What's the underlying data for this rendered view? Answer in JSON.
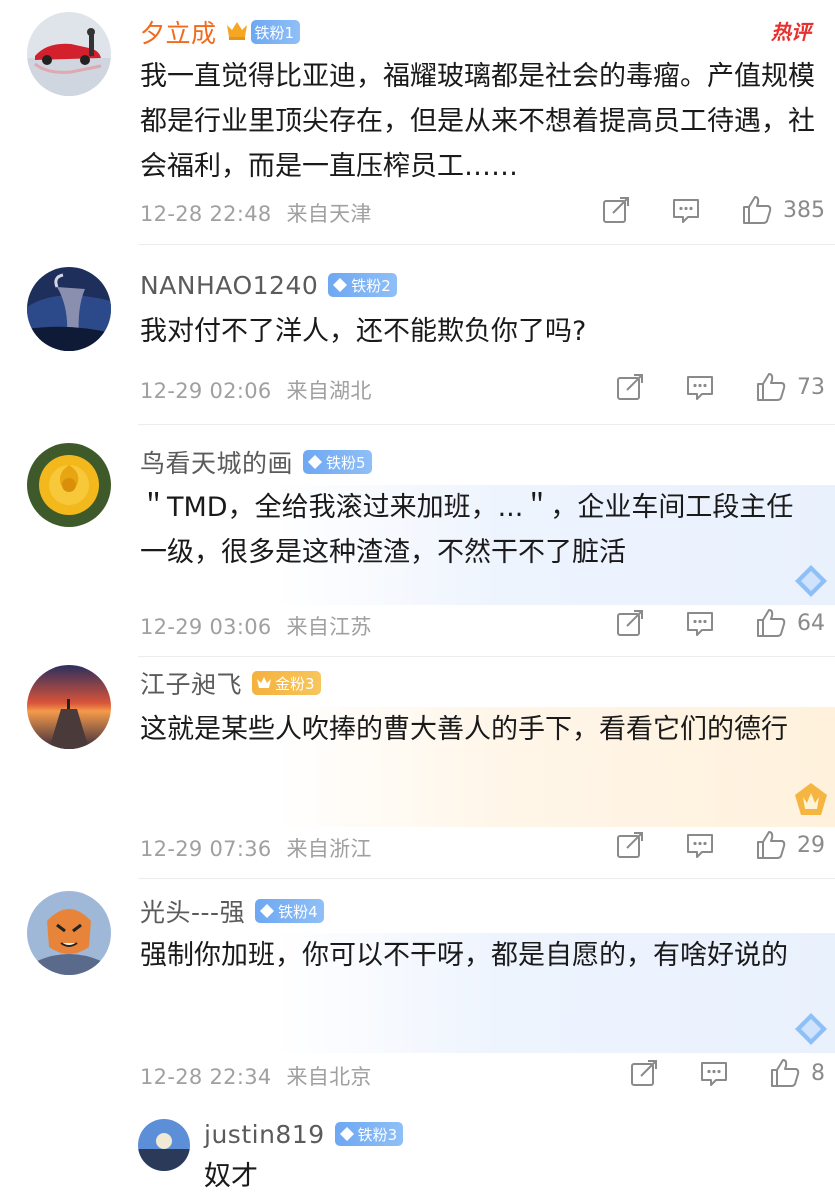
{
  "hot_label": "热评",
  "comments": [
    {
      "name": "夕立成",
      "badge": "铁粉1",
      "text": "我一直觉得比亚迪，福耀玻璃都是社会的毒瘤。产值规模都是行业里顶尖存在，但是从来不想着提高员工待遇，社会福利，而是一直压榨员工……",
      "time": "12-28 22:48",
      "location": "来自天津",
      "likes": "385"
    },
    {
      "name": "NANHAO1240",
      "badge": "铁粉2",
      "text": "我对付不了洋人，还不能欺负你了吗?",
      "time": "12-29 02:06",
      "location": "来自湖北",
      "likes": "73"
    },
    {
      "name": "鸟看天城的画",
      "badge": "铁粉5",
      "text": "＂TMD，全给我滚过来加班，...＂，企业车间工段主任一级，很多是这种渣渣，不然干不了脏活",
      "time": "12-29 03:06",
      "location": "来自江苏",
      "likes": "64"
    },
    {
      "name": "江子昶飞",
      "badge": "金粉3",
      "text": "这就是某些人吹捧的曹大善人的手下，看看它们的德行",
      "time": "12-29 07:36",
      "location": "来自浙江",
      "likes": "29"
    },
    {
      "name": "光头---强",
      "badge": "铁粉4",
      "text": "强制你加班，你可以不干呀，都是自愿的，有啥好说的",
      "time": "12-28 22:34",
      "location": "来自北京",
      "likes": "8"
    }
  ],
  "reply": {
    "name": "justin819",
    "badge": "铁粉3",
    "text": "奴才"
  },
  "colors": {
    "vip_name": "#f26a1b",
    "name": "#5b5b5b",
    "meta": "#a0a0a0",
    "hot": "#e8312f",
    "iron_badge": "#7fb2f4",
    "gold_badge": "#f5b540"
  },
  "icons": [
    "repost-icon",
    "comment-icon",
    "like-icon",
    "crown-icon",
    "diamond-icon"
  ]
}
